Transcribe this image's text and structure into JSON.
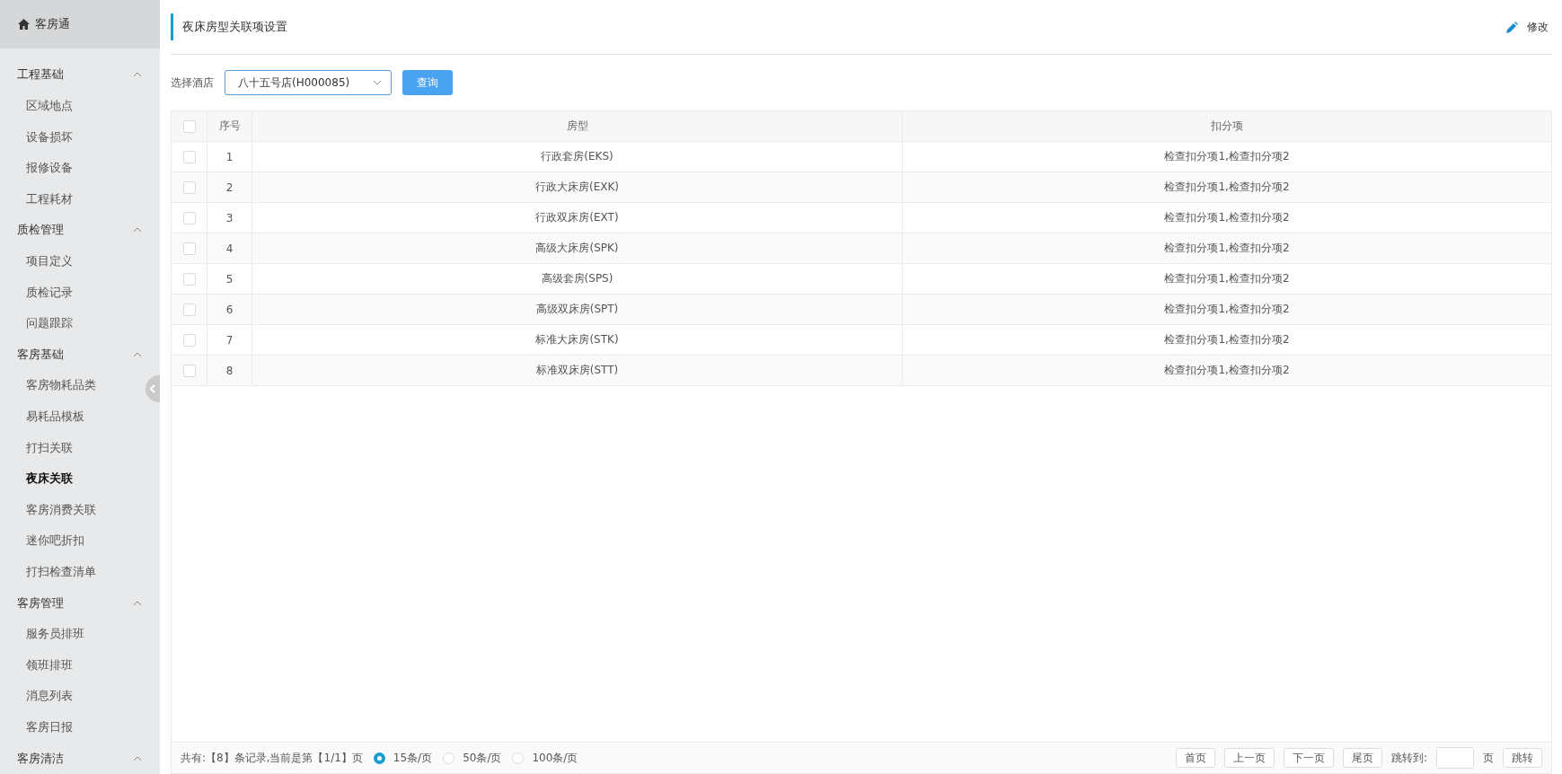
{
  "sidebar": {
    "title": "客房通",
    "groups": [
      {
        "label": "工程基础",
        "expanded": true,
        "items": [
          {
            "label": "区域地点",
            "selected": false
          },
          {
            "label": "设备损坏",
            "selected": false
          },
          {
            "label": "报修设备",
            "selected": false
          },
          {
            "label": "工程耗材",
            "selected": false
          }
        ]
      },
      {
        "label": "质检管理",
        "expanded": true,
        "items": [
          {
            "label": "项目定义",
            "selected": false
          },
          {
            "label": "质检记录",
            "selected": false
          },
          {
            "label": "问题跟踪",
            "selected": false
          }
        ]
      },
      {
        "label": "客房基础",
        "expanded": true,
        "items": [
          {
            "label": "客房物耗品类",
            "selected": false
          },
          {
            "label": "易耗品模板",
            "selected": false
          },
          {
            "label": "打扫关联",
            "selected": false
          },
          {
            "label": "夜床关联",
            "selected": true
          },
          {
            "label": "客房消费关联",
            "selected": false
          },
          {
            "label": "迷你吧折扣",
            "selected": false
          },
          {
            "label": "打扫检查清单",
            "selected": false
          }
        ]
      },
      {
        "label": "客房管理",
        "expanded": true,
        "items": [
          {
            "label": "服务员排班",
            "selected": false
          },
          {
            "label": "领班排班",
            "selected": false
          },
          {
            "label": "消息列表",
            "selected": false
          },
          {
            "label": "客房日报",
            "selected": false
          }
        ]
      },
      {
        "label": "客房清洁",
        "expanded": true
      }
    ]
  },
  "header": {
    "title": "夜床房型关联项设置",
    "edit_button": "修改"
  },
  "filter": {
    "label": "选择酒店",
    "hotel": "八十五号店(H000085)",
    "query_button": "查询"
  },
  "table": {
    "columns": [
      "序号",
      "房型",
      "扣分项"
    ],
    "all_checked": false,
    "rows": [
      {
        "checked": false,
        "no": "1",
        "room_type": "行政套房(EKS)",
        "deductions": "检查扣分项1,检查扣分项2"
      },
      {
        "checked": false,
        "no": "2",
        "room_type": "行政大床房(EXK)",
        "deductions": "检查扣分项1,检查扣分项2"
      },
      {
        "checked": false,
        "no": "3",
        "room_type": "行政双床房(EXT)",
        "deductions": "检查扣分项1,检查扣分项2"
      },
      {
        "checked": false,
        "no": "4",
        "room_type": "高级大床房(SPK)",
        "deductions": "检查扣分项1,检查扣分项2"
      },
      {
        "checked": false,
        "no": "5",
        "room_type": "高级套房(SPS)",
        "deductions": "检查扣分项1,检查扣分项2"
      },
      {
        "checked": false,
        "no": "6",
        "room_type": "高级双床房(SPT)",
        "deductions": "检查扣分项1,检查扣分项2"
      },
      {
        "checked": false,
        "no": "7",
        "room_type": "标准大床房(STK)",
        "deductions": "检查扣分项1,检查扣分项2"
      },
      {
        "checked": false,
        "no": "8",
        "room_type": "标准双床房(STT)",
        "deductions": "检查扣分项1,检查扣分项2"
      }
    ]
  },
  "pagination": {
    "summary": "共有:【8】条记录,当前是第【1/1】页",
    "page_sizes": [
      {
        "label": "15条/页",
        "selected": true
      },
      {
        "label": "50条/页",
        "selected": false
      },
      {
        "label": "100条/页",
        "selected": false
      }
    ],
    "buttons": [
      "首页",
      "上一页",
      "下一页",
      "尾页"
    ],
    "jump_label": "跳转到:",
    "page_unit": "页",
    "jump_button": "跳转"
  }
}
